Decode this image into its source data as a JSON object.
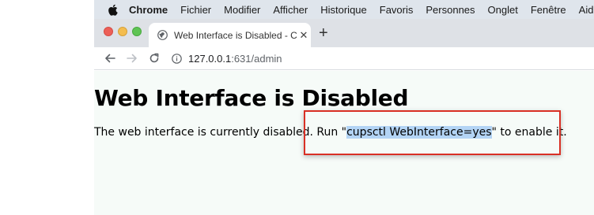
{
  "menubar": {
    "app": "Chrome",
    "items": [
      "Fichier",
      "Modifier",
      "Afficher",
      "Historique",
      "Favoris",
      "Personnes",
      "Onglet",
      "Fenêtre",
      "Aide"
    ]
  },
  "tab": {
    "title": "Web Interface is Disabled - CUPS",
    "close": "✕",
    "new_tab": "+"
  },
  "address": {
    "host": "127.0.0.1",
    "rest": ":631/admin"
  },
  "page": {
    "heading": "Web Interface is Disabled",
    "msg_prefix": "The web interface is currently disabled. Run \"",
    "command": "cupsctl WebInterface=yes",
    "msg_suffix": "\" to enable it."
  },
  "colors": {
    "annotation": "#d93025",
    "selection": "#b3d4f5"
  }
}
